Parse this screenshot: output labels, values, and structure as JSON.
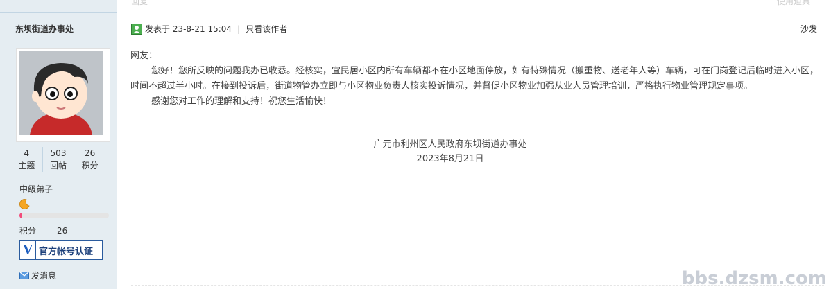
{
  "top": {
    "left_faded": "回复",
    "right_faded": "使用道具"
  },
  "author": {
    "name": "东坝街道办事处",
    "stats": [
      {
        "num": "4",
        "label": "主题"
      },
      {
        "num": "503",
        "label": "回帖"
      },
      {
        "num": "26",
        "label": "积分"
      }
    ],
    "rank": "中级弟子",
    "rank_icon": "moon-icon",
    "progress_fraction": 0.02,
    "points_label": "积分",
    "points_value": "26",
    "verify_badge": {
      "icon_letter": "V",
      "text": "官方帐号认证"
    },
    "message_link": "发消息"
  },
  "post": {
    "posted_at": "发表于 23-8-21 15:04",
    "only_author": "只看该作者",
    "floor": "沙发",
    "greeting": "网友：",
    "body": "您好！您所反映的问题我办已收悉。经核实，宜民居小区内所有车辆都不在小区地面停放，如有特殊情况（搬重物、送老年人等）车辆，可在门岗登记后临时进入小区，时间不超过半小时。在接到投诉后，街道物管办立即与小区物业负责人核实投诉情况，并督促小区物业加强从业人员管理培训，严格执行物业管理规定事项。",
    "thanks": "感谢您对工作的理解和支持！祝您生活愉快！",
    "sign_org": "广元市利州区人民政府东坝街道办事处",
    "sign_date": "2023年8月21日"
  },
  "watermark": "bbs.dzsm.com",
  "colors": {
    "sidebar_bg": "#e5edf2",
    "progress_fill": "#f24c7b",
    "verify_border": "#2a5b9e"
  }
}
